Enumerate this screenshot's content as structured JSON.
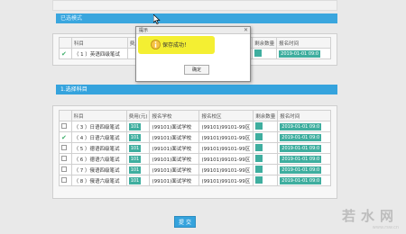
{
  "section1": {
    "title": "已选模式"
  },
  "section2": {
    "title": "1.选择科目"
  },
  "table1": {
    "headers": [
      "",
      "科目",
      "费用",
      "报名学校",
      "报名校区",
      "剩余数量",
      "报名时间"
    ],
    "rows": [
      {
        "checked": true,
        "subject": "（ 1 ）英语四级笔试",
        "fee": "",
        "school": "",
        "campus": "",
        "remain": "",
        "time": "2019-01-01 09:0"
      }
    ]
  },
  "table2": {
    "headers": [
      "",
      "科目",
      "费用(元)",
      "报名学校",
      "报名校区",
      "剩余数量",
      "报名时间"
    ],
    "rows": [
      {
        "checked": false,
        "subject": "（ 3 ）日语四级笔试",
        "fee": "101",
        "school": "(99101)面试学校",
        "campus": "(99101)99101-99区",
        "remain": "",
        "time": "2019-01-01 09:0"
      },
      {
        "checked": true,
        "subject": "（ 4 ）日语六级笔试",
        "fee": "101",
        "school": "(99101)面试学校",
        "campus": "(99101)99101-99区",
        "remain": "",
        "time": "2019-01-01 09:0"
      },
      {
        "checked": false,
        "subject": "（ 5 ）德语四级笔试",
        "fee": "101",
        "school": "(99101)面试学校",
        "campus": "(99101)99101-99区",
        "remain": "",
        "time": "2019-01-01 09:0"
      },
      {
        "checked": false,
        "subject": "（ 6 ）德语六级笔试",
        "fee": "101",
        "school": "(99101)面试学校",
        "campus": "(99101)99101-99区",
        "remain": "",
        "time": "2019-01-01 09:0"
      },
      {
        "checked": false,
        "subject": "（ 7 ）俄语四级笔试",
        "fee": "101",
        "school": "(99101)面试学校",
        "campus": "(99101)99101-99区",
        "remain": "",
        "time": "2019-01-01 09:0"
      },
      {
        "checked": false,
        "subject": "（ 8 ）俄语六级笔试",
        "fee": "101",
        "school": "(99101)面试学校",
        "campus": "(99101)99101-99区",
        "remain": "",
        "time": "2019-01-01 09:0"
      }
    ]
  },
  "submit": {
    "label": "提 交"
  },
  "dialog": {
    "title": "提示",
    "close": "✕",
    "message": "保存成功！",
    "ok": "确定"
  },
  "watermark": {
    "main": "若水网",
    "sub": "www.rsw.cn"
  },
  "colors": {
    "accent": "#35a3dd",
    "cell_badge": "#3fae9f",
    "highlight": "#f3ee27"
  }
}
